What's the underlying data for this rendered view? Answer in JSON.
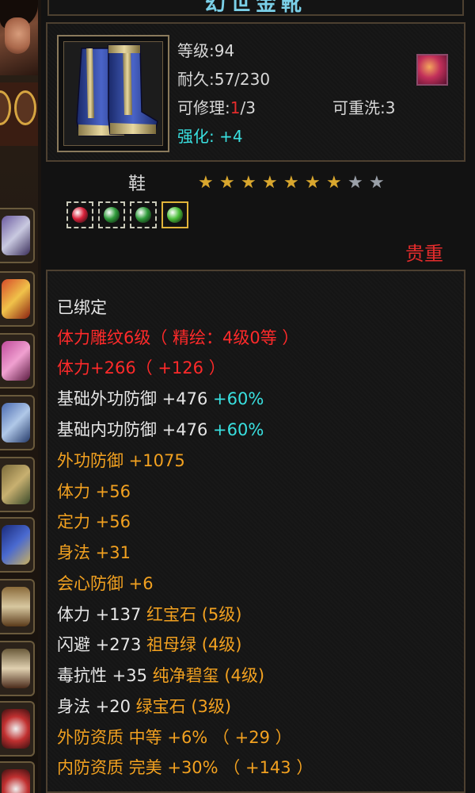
{
  "window": {
    "title": "幻世金靴"
  },
  "item": {
    "level": "等级:94",
    "durability": "耐久:57/230",
    "repair_prefix": "可修理:",
    "repair_used": "1",
    "repair_total": "/3",
    "rewash": "可重洗:3",
    "enhance_label": "强化: ",
    "enhance_value": "+4",
    "type": "鞋",
    "stars_filled": 7,
    "stars_total": 9,
    "rarity": "贵重"
  },
  "gems": [
    {
      "name": "red-gem",
      "color": "#d8213a"
    },
    {
      "name": "green-gem",
      "color": "#2f9b3a"
    },
    {
      "name": "green-gem",
      "color": "#2f9b3a"
    },
    {
      "name": "green-gem-selected",
      "color": "#4bbf3a"
    }
  ],
  "attributes": {
    "bound": "已绑定",
    "carve": "体力雕纹6级（ 精绘：4级0等 ）",
    "stamina_bonus": "体力+266（ +126 ）",
    "base_outer_def": {
      "label": "基础外功防御  +476 ",
      "pct": "+60%"
    },
    "base_inner_def": {
      "label": "基础内功防御  +476 ",
      "pct": "+60%"
    },
    "outer_def": "外功防御  +1075",
    "stamina": "体力  +56",
    "focus": "定力  +56",
    "agility": "身法  +31",
    "crit_def": "会心防御  +6",
    "gem_1": {
      "stat": "体力  +137  ",
      "gem": "红宝石 (5级)"
    },
    "gem_2": {
      "stat": "闪避  +273  ",
      "gem": "祖母绿 (4级)"
    },
    "gem_3": {
      "stat": "毒抗性  +35  ",
      "gem": "纯净碧玺 (4级)"
    },
    "gem_4": {
      "stat": "身法  +20  ",
      "gem": "绿宝石 (3级)"
    },
    "quality_outer": "外防资质    中等  +6%  （ +29 ）",
    "quality_inner": "内防资质    完美  +30%  （ +143 ）"
  },
  "colors": {
    "white": "#e6e6e6",
    "red": "#ff2a2a",
    "orange": "#f2a120",
    "cyan": "#39e0e0"
  }
}
